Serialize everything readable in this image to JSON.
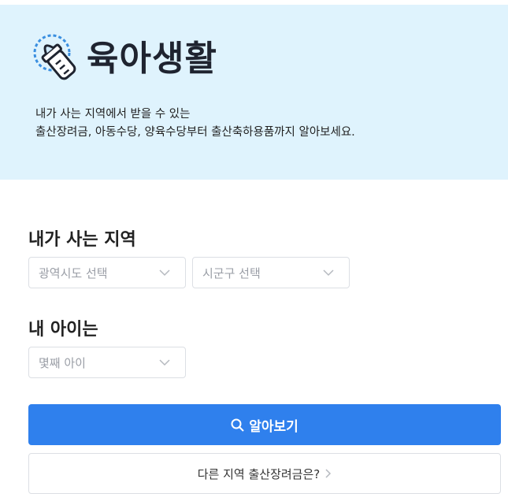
{
  "hero": {
    "logo_text": "육아생활",
    "desc_line1": "내가 사는 지역에서 받을 수 있는",
    "desc_line2": "출산장려금, 아동수당, 양육수당부터 출산축하용품까지 알아보세요.",
    "background": "#dff3fd"
  },
  "region": {
    "title": "내가 사는 지역",
    "province_placeholder": "광역시도 선택",
    "district_placeholder": "시군구 선택"
  },
  "child": {
    "title": "내 아이는",
    "order_placeholder": "몇째 아이"
  },
  "actions": {
    "search_label": "알아보기",
    "other_region_label": "다른 지역 출산장려금은?",
    "accent": "#2f80ed"
  },
  "icons": {
    "logo": "baby-bottle-icon",
    "search": "search-icon",
    "dropdown": "chevron-down-icon",
    "next": "chevron-right-icon"
  }
}
